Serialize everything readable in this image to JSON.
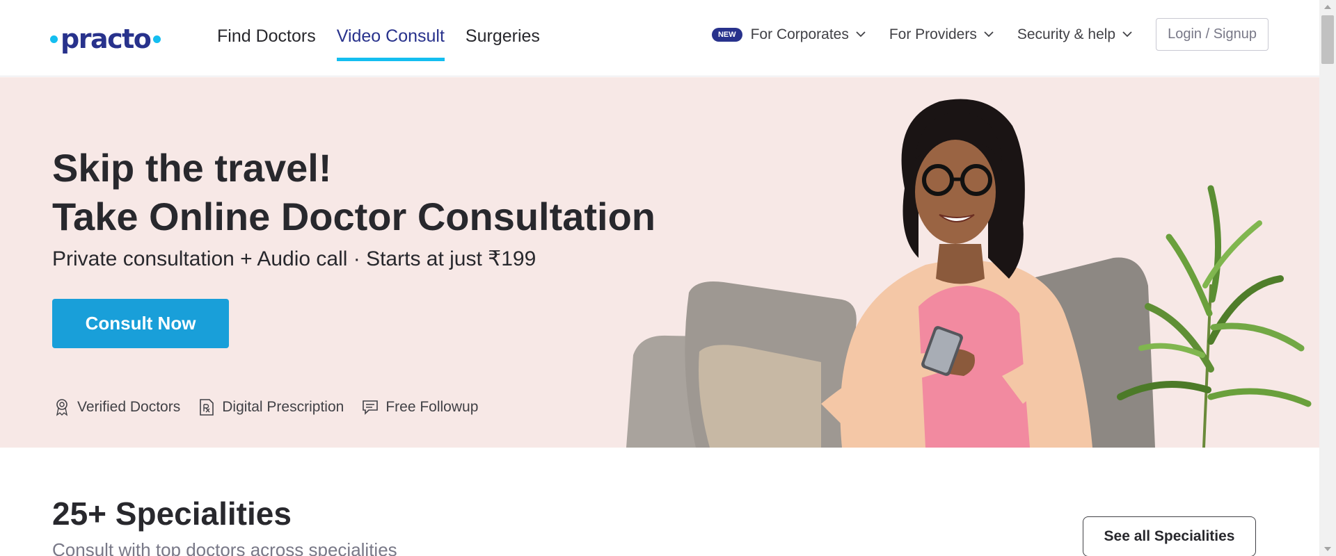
{
  "header": {
    "logo_text": "practo",
    "nav_main": [
      {
        "label": "Find Doctors",
        "active": false
      },
      {
        "label": "Video Consult",
        "active": true
      },
      {
        "label": "Surgeries",
        "active": false
      }
    ],
    "new_badge": "NEW",
    "nav_right": [
      {
        "label": "For Corporates"
      },
      {
        "label": "For Providers"
      },
      {
        "label": "Security & help"
      }
    ],
    "login_label": "Login / Signup"
  },
  "hero": {
    "title_line1": "Skip the travel!",
    "title_line2": "Take Online Doctor Consultation",
    "subtitle": "Private consultation + Audio call · Starts at just ₹199",
    "cta_label": "Consult Now",
    "features": [
      {
        "label": "Verified Doctors",
        "icon": "verified-badge-icon"
      },
      {
        "label": "Digital Prescription",
        "icon": "prescription-icon"
      },
      {
        "label": "Free Followup",
        "icon": "chat-icon"
      }
    ]
  },
  "specialities": {
    "title": "25+ Specialities",
    "subtitle": "Consult with top doctors across specialities",
    "see_all_label": "See all Specialities"
  },
  "colors": {
    "brand_cyan": "#14bef0",
    "brand_navy": "#28328c",
    "hero_bg": "#f7e8e6",
    "cta_blue": "#199fd9"
  }
}
